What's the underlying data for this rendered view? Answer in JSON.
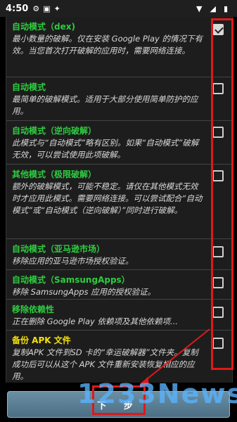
{
  "status_bar": {
    "time": "4:50"
  },
  "options": [
    {
      "title": "自动模式（dex)",
      "desc": "最小数量的破解。仅在安装 Google Play 的情况下有效。当您首次打开破解的应用时，需要网络连接。",
      "checked": true,
      "title_color": "green"
    },
    {
      "title": "自动模式",
      "desc": "最简单的破解模式。适用于大部分使用简单防护的应用。",
      "checked": false,
      "title_color": "green"
    },
    {
      "title": "自动模式（逆向破解）",
      "desc": "此模式与“自动模式”略有区别。如果“自动模式”破解无效，可以尝试使用此项破解。",
      "checked": false,
      "title_color": "green"
    },
    {
      "title": "其他模式（极限破解）",
      "desc": "额外的破解模式，可能不稳定。请仅在其他模式无效时才应用此模式。需要网络连接。可以尝试配合“自动模式”或“自动模式（逆向破解）”同时进行破解。",
      "checked": false,
      "title_color": "green"
    },
    {
      "title": "自动模式（亚马逊市场）",
      "desc": "移除应用的亚马逊市场授权验证。",
      "checked": false,
      "title_color": "green"
    },
    {
      "title": "自动模式（SamsungApps）",
      "desc": "移除 SamsungApps 应用的授权验证。",
      "checked": false,
      "title_color": "green"
    },
    {
      "title": "移除依赖性",
      "desc": "正在删除 Google Play 依赖项及其他依赖项...",
      "checked": false,
      "title_color": "green"
    },
    {
      "title": "备份 APK 文件",
      "desc": "复制APK 文件到SD 卡的“幸运破解器”文件夹。复制成功后可以从这个 APK 文件重新安装恢复相应的应用。",
      "checked": false,
      "title_color": "yellow"
    }
  ],
  "next_button": {
    "label": "下 步"
  },
  "watermark": {
    "text": "1233News"
  },
  "colors": {
    "highlight": "#e01818",
    "title_green": "#2ecc40",
    "title_yellow": "#f5e10a",
    "button": "#5a7e94"
  }
}
